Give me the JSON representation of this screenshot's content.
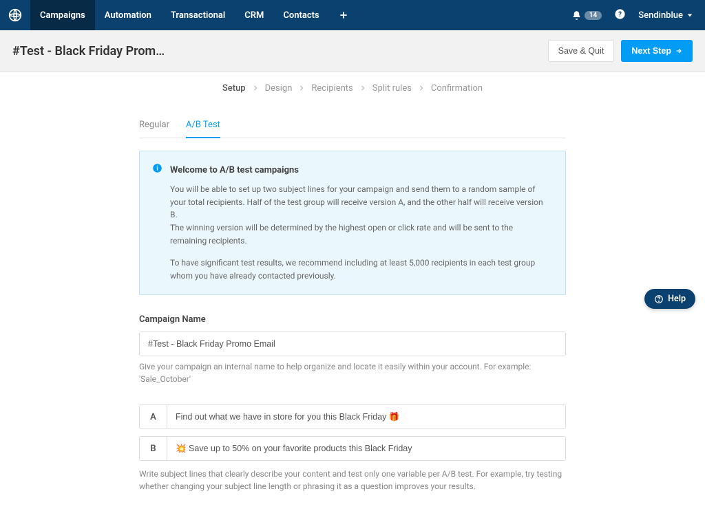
{
  "nav": {
    "items": [
      "Campaigns",
      "Automation",
      "Transactional",
      "CRM",
      "Contacts"
    ],
    "active_index": 0,
    "notification_count": "14",
    "account_label": "Sendinblue"
  },
  "header": {
    "title": "#Test - Black Friday Prom…",
    "save_quit_label": "Save & Quit",
    "next_step_label": "Next Step"
  },
  "steps": {
    "items": [
      "Setup",
      "Design",
      "Recipients",
      "Split rules",
      "Confirmation"
    ],
    "active_index": 0
  },
  "tabs": {
    "items": [
      "Regular",
      "A/B Test"
    ],
    "active_index": 1
  },
  "info": {
    "title": "Welcome to A/B test campaigns",
    "line1": "You will be able to set up two subject lines for your campaign and send them to a random sample of your total recipients. Half of the test group will receive version A, and the other half will receive version B.",
    "line2": "The winning version will be determined by the highest open or click rate and will be sent to the remaining recipients.",
    "line3": "To have significant test results, we recommend including at least 5,000 recipients in each test group whom you have already contacted previously."
  },
  "campaign_name": {
    "label": "Campaign Name",
    "value": "#Test - Black Friday Promo Email",
    "help": "Give your campaign an internal name to help organize and locate it easily within your account. For example: 'Sale_October'"
  },
  "subjects": {
    "a": {
      "letter": "A",
      "value": "Find out what we have in store for you this Black Friday 🎁"
    },
    "b": {
      "letter": "B",
      "value": "💥 Save up to 50% on your favorite products this Black Friday"
    },
    "help": "Write subject lines that clearly describe your content and test only one variable per A/B test. For example, try testing whether changing your subject line length or phrasing it as a question improves your results."
  },
  "help_float": {
    "label": "Help"
  }
}
